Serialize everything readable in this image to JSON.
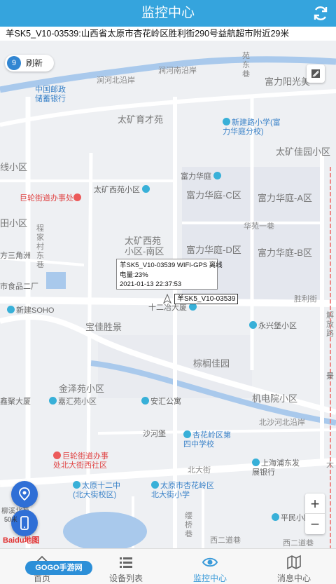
{
  "header": {
    "title": "监控中心"
  },
  "address_bar": {
    "text": "羊SK5_V10-03539:山西省太原市杏花岭区胜利街290号益航超市附近29米"
  },
  "map": {
    "refresh": {
      "count": "9",
      "label": "刷新"
    },
    "info_window": {
      "line1": "羊SK5_V10-03539 WIFI-GPS 离线",
      "line2": "电量:23%",
      "line3": "2021-01-13 22:37:53"
    },
    "device_label": "羊SK5_V10-03539",
    "labels": {
      "l1": "涧河北沿岸",
      "l2": "涧河南沿岸",
      "l3": "苑东巷",
      "l4": "富力阳光美",
      "l5": "中国邮政储蓄银行",
      "l6": "太矿育才苑",
      "l7": "新建路小学(富力华庭分校)",
      "l8": "太矿佳园小区",
      "l9": "线小区",
      "l10": "富力华庭",
      "l11": "巨轮街道办事处",
      "l12": "太矿西苑小区",
      "l13": "富力华庭-C区",
      "l14": "富力华庭-A区",
      "l15": "田小区",
      "l16": "程家村东巷",
      "l17": "华苑一巷",
      "l18": "太矿西苑小区-南区",
      "l19": "富力华庭-D区",
      "l20": "富力华庭-B区",
      "l21": "方三角洲",
      "l22": "市食品二厂",
      "l23": "十二冶大厦",
      "l24": "胜利街",
      "l25": "新建SOHO",
      "l26": "宝佳胜景",
      "l27": "永兴堡小区",
      "l28": "棕榈佳园",
      "l29": "解放路",
      "l30": "金泽苑小区",
      "l31": "鑫聚大厦",
      "l32": "嘉汇苑小区",
      "l33": "安汇公寓",
      "l34": "机电院小区",
      "l35": "北沙河北沿岸",
      "l36": "沙河堡",
      "l37": "杏花岭区第四中学校",
      "l38": "巨轮街道办事处北大街西社区",
      "l39": "北大街",
      "l40": "上海浦东发展银行",
      "l41": "大",
      "l42": "太原十二中(北大街校区)",
      "l43": "太原市杏花岭区北大街小学",
      "l44": "柳溪北苑",
      "l45": "缨桥巷",
      "l46": "平民小区",
      "l47": "西二道巷",
      "l48": "西二道巷",
      "l49": "景"
    },
    "scale": "50米",
    "baidu_logo": "Baidu地图"
  },
  "tabs": [
    {
      "label": "首页",
      "icon": "home-icon"
    },
    {
      "label": "设备列表",
      "icon": "list-icon"
    },
    {
      "label": "监控中心",
      "icon": "eye-icon"
    },
    {
      "label": "消息中心",
      "icon": "map-icon"
    }
  ],
  "watermark": "GOGO手游网",
  "colors": {
    "header": "#35a4dd",
    "active_tab": "#3a9ad9",
    "fab": "#2f6fd6"
  }
}
